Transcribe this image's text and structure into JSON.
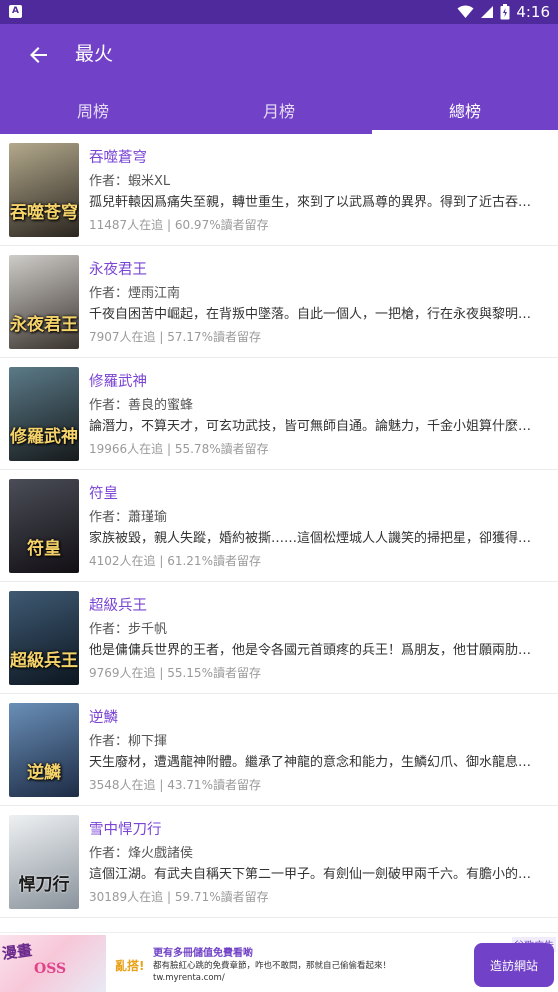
{
  "status_bar": {
    "notification_icon": "notification-a-icon",
    "time": "4:16",
    "icons": [
      "wifi-icon",
      "signal-icon",
      "battery-icon"
    ]
  },
  "toolbar": {
    "back_icon": "back-arrow-icon",
    "title": "最火"
  },
  "tabs": [
    {
      "label": "周榜",
      "active": false
    },
    {
      "label": "月榜",
      "active": false
    },
    {
      "label": "總榜",
      "active": true
    }
  ],
  "books": [
    {
      "title": "吞噬蒼穹",
      "author": "作者：蝦米XL",
      "desc": "孤兒軒轅因爲痛失至親，轉世重生，來到了以武爲尊的異界。得到了近古吞噬精華能力，要不斷吞噬…",
      "stats": "11487人在追 | 60.97%讀者留存",
      "cover_text": "吞噬苍穹",
      "cover_colors": [
        "#b3a98c",
        "#2a2520"
      ]
    },
    {
      "title": "永夜君王",
      "author": "作者：煙雨江南",
      "desc": "千夜自困苦中崛起，在背叛中墜落。自此一個人，一把槍，行在永夜與黎明之間，卻走出一段傳奇…",
      "stats": "7907人在追 | 57.17%讀者留存",
      "cover_text": "永夜君王",
      "cover_colors": [
        "#cfcdc9",
        "#3a332e"
      ]
    },
    {
      "title": "修羅武神",
      "author": "作者：善良的蜜蜂",
      "desc": "論潛力，不算天才，可玄功武技，皆可無師自通。論魅力，千金小姐算什麼，公主女王都爲我神魂…",
      "stats": "19966人在追 | 55.78%讀者留存",
      "cover_text": "修羅武神",
      "cover_colors": [
        "#5b7a88",
        "#161a1c"
      ]
    },
    {
      "title": "符皇",
      "author": "作者：蕭瑾瑜",
      "desc": "家族被毀，親人失蹤，婚約被撕……這個松煙城人人譏笑的掃把星，卻獲得百世符皇的傳承，從此…",
      "stats": "4102人在追 | 61.21%讀者留存",
      "cover_text": "符皇",
      "cover_colors": [
        "#4a4d57",
        "#120f14"
      ]
    },
    {
      "title": "超級兵王",
      "author": "作者：步千帆",
      "desc": "他是傭傭兵世界的王者，他是令各國元首頭疼的兵王！爲朋友，他甘願兩肋插刀，爲女人，他敢殺…",
      "stats": "9769人在追 | 55.15%讀者留存",
      "cover_text": "超級兵王",
      "cover_colors": [
        "#3f5a73",
        "#0c1620"
      ]
    },
    {
      "title": "逆鱗",
      "author": "作者：柳下揮",
      "desc": "天生廢材，遭遇龍神附體。繼承了神龍的意念和能力，生鱗幻爪、御水龍息、行雲布雨……",
      "stats": "3548人在追 | 43.71%讀者留存",
      "cover_text": "逆鱗",
      "cover_colors": [
        "#6a8fb8",
        "#1d2c45"
      ]
    },
    {
      "title": "雪中悍刀行",
      "author": "作者：烽火戲諸侯",
      "desc": "這個江湖。有武夫自稱天下第二一甲子。有劍仙一劍破甲兩千六。有膽小的長公主，也有說書的老…",
      "stats": "30189人在追 | 59.71%讀者留存",
      "cover_text": "悍刀行",
      "cover_colors": [
        "#eef1f3",
        "#8a939c"
      ]
    }
  ],
  "ad": {
    "image_text_1": "漫畫",
    "image_text_2": "OSS",
    "brand": "亂搭!",
    "headline": "更有多冊儲值免費看喲",
    "sub": "都有臉紅心跳的免費章節，咋也不敢問，那就自己偷偷看起來！",
    "url": "tw.myrenta.com/",
    "label": "谷歌广告",
    "cta": "造訪網站"
  }
}
